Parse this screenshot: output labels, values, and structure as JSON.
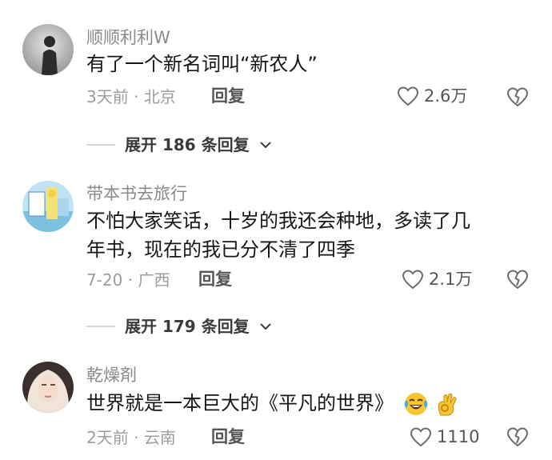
{
  "comments": [
    {
      "username": "顺顺利利W",
      "text_lines": [
        "有了一个新名词叫“新农人”"
      ],
      "time": "3天前",
      "sep": "·",
      "location": "北京",
      "reply_label": "回复",
      "likes": "2.6万",
      "expand_label": "展开 186 条回复"
    },
    {
      "username": "带本书去旅行",
      "text_lines": [
        "不怕大家笑话，十岁的我还会种地，多读了几",
        "年书，现在的我已分不清了四季"
      ],
      "time": "7-20",
      "sep": "·",
      "location": "广西",
      "reply_label": "回复",
      "likes": "2.1万",
      "expand_label": "展开 179 条回复"
    },
    {
      "username": "乾燥剤",
      "text_lines": [
        "世界就是一本巨大的《平凡的世界》"
      ],
      "emojis": [
        "laughing-tears-icon",
        "ok-hand-icon"
      ],
      "time": "2天前",
      "sep": "·",
      "location": "云南",
      "reply_label": "回复",
      "likes": "1110"
    }
  ],
  "colors": {
    "text": "#161616",
    "muted": "#9c9c9c",
    "username": "#8a8a8a"
  }
}
